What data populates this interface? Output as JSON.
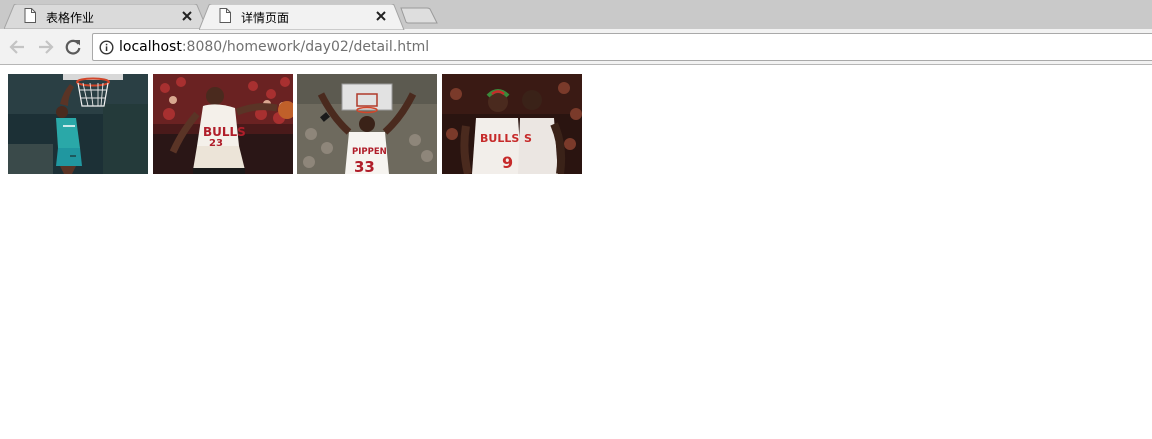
{
  "browser": {
    "tabs": [
      {
        "title": "表格作业",
        "active": false
      },
      {
        "title": "详情页面",
        "active": true
      }
    ],
    "address": {
      "host": "localhost",
      "rest": ":8080/homework/day02/detail.html"
    },
    "icons": {
      "tab": "page-icon",
      "close": "close-icon",
      "back": "back-arrow-icon",
      "forward": "forward-arrow-icon",
      "reload": "reload-icon",
      "info": "info-icon",
      "new_tab": "new-tab-icon"
    }
  },
  "photos": [
    {
      "id": "dunk",
      "accent": "#2aa8a8"
    },
    {
      "id": "drive",
      "accent": "#b01e2a"
    },
    {
      "id": "back-view",
      "accent": "#f0f0f0"
    },
    {
      "id": "teammates",
      "accent": "#c62a2a"
    }
  ]
}
